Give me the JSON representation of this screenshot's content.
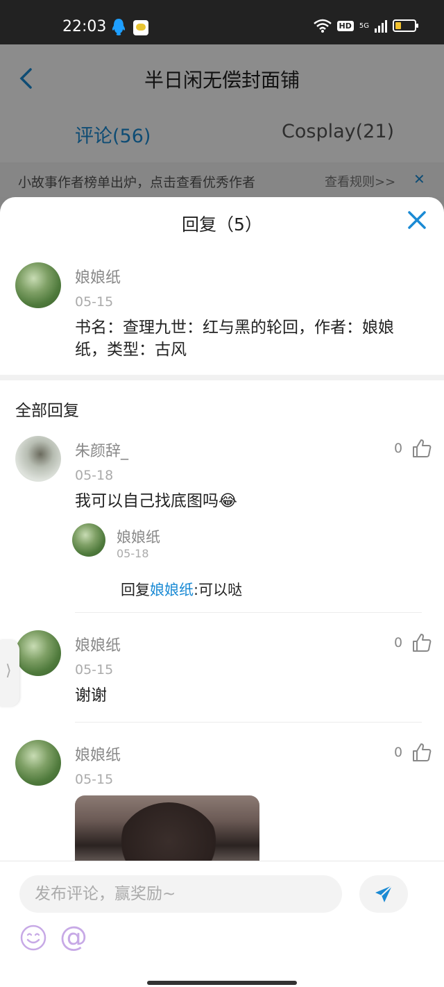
{
  "status_bar": {
    "time": "22:03",
    "network": "5G",
    "hd": "HD"
  },
  "background_page": {
    "title": "半日闲无偿封面铺",
    "tabs": [
      {
        "label": "评论(56)",
        "active": true
      },
      {
        "label": "Cosplay(21)",
        "active": false
      }
    ],
    "notice": {
      "text": "小故事作者榜单出炉，点击查看优秀作者",
      "link": "查看规则>>"
    }
  },
  "sheet": {
    "title": "回复（5）",
    "original_post": {
      "name": "娘娘纸",
      "date": "05-15",
      "text": "书名：查理九世：红与黑的轮回，作者：娘娘纸，类型：古风"
    },
    "section_title": "全部回复",
    "replies": [
      {
        "name": "朱颜辞_",
        "date": "05-18",
        "text": "我可以自己找底图吗😂",
        "likes": "0",
        "sub_reply": {
          "name": "娘娘纸",
          "date": "05-18",
          "prefix": "回复",
          "target": "娘娘纸",
          "text": ":可以哒"
        }
      },
      {
        "name": "娘娘纸",
        "date": "05-15",
        "text": "谢谢",
        "likes": "0"
      },
      {
        "name": "娘娘纸",
        "date": "05-15",
        "text": "",
        "likes": "0"
      }
    ]
  },
  "bottom_bar": {
    "placeholder": "发布评论，赢奖励~"
  },
  "colors": {
    "accent": "#1a8ad4",
    "icon_purple": "#c7a9e6"
  }
}
